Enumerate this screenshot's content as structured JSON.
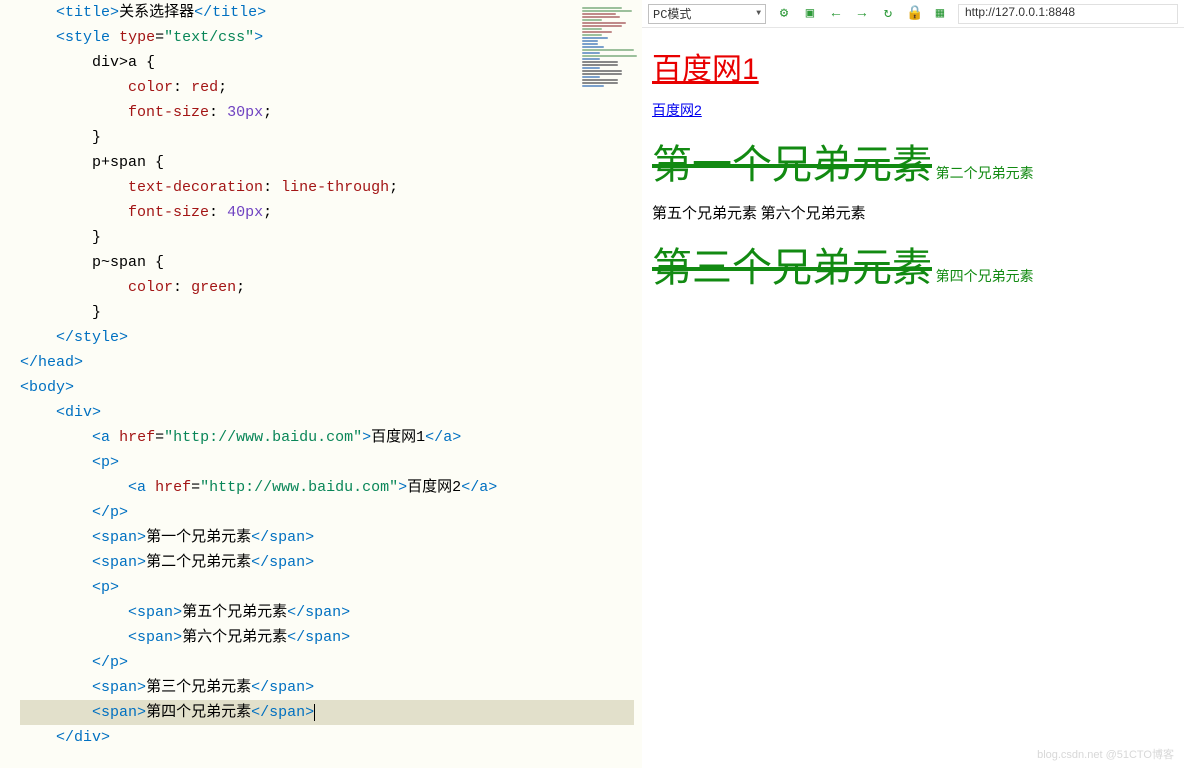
{
  "code": {
    "lines": [
      [
        [
          "sp",
          "    "
        ],
        [
          "b",
          "<"
        ],
        [
          "tag",
          "title"
        ],
        [
          "b",
          ">"
        ],
        [
          "text",
          "关系选择器"
        ],
        [
          "b",
          "</"
        ],
        [
          "tag",
          "title"
        ],
        [
          "b",
          ">"
        ]
      ],
      [
        [
          "sp",
          "    "
        ],
        [
          "b",
          "<"
        ],
        [
          "tag",
          "style"
        ],
        [
          "text",
          " "
        ],
        [
          "attr",
          "type"
        ],
        [
          "text",
          "="
        ],
        [
          "str",
          "\"text/css\""
        ],
        [
          "b",
          ">"
        ]
      ],
      [
        [
          "sp",
          "        "
        ],
        [
          "sel",
          "div>a {"
        ]
      ],
      [
        [
          "sp",
          "            "
        ],
        [
          "prop",
          "color"
        ],
        [
          "text",
          ": "
        ],
        [
          "valr",
          "red"
        ],
        [
          "text",
          ";"
        ]
      ],
      [
        [
          "sp",
          "            "
        ],
        [
          "prop",
          "font-size"
        ],
        [
          "text",
          ": "
        ],
        [
          "valn",
          "30px"
        ],
        [
          "text",
          ";"
        ]
      ],
      [
        [
          "sp",
          "        "
        ],
        [
          "sel",
          "}"
        ]
      ],
      [
        [
          "sp",
          "        "
        ],
        [
          "sel",
          "p+span {"
        ]
      ],
      [
        [
          "sp",
          "            "
        ],
        [
          "prop",
          "text-decoration"
        ],
        [
          "text",
          ": "
        ],
        [
          "valr",
          "line-through"
        ],
        [
          "text",
          ";"
        ]
      ],
      [
        [
          "sp",
          "            "
        ],
        [
          "prop",
          "font-size"
        ],
        [
          "text",
          ": "
        ],
        [
          "valn",
          "40px"
        ],
        [
          "text",
          ";"
        ]
      ],
      [
        [
          "sp",
          "        "
        ],
        [
          "sel",
          "}"
        ]
      ],
      [
        [
          "sp",
          "        "
        ],
        [
          "sel",
          "p~span {"
        ]
      ],
      [
        [
          "sp",
          "            "
        ],
        [
          "prop",
          "color"
        ],
        [
          "text",
          ": "
        ],
        [
          "valr",
          "green"
        ],
        [
          "text",
          ";"
        ]
      ],
      [
        [
          "sp",
          "        "
        ],
        [
          "sel",
          "}"
        ]
      ],
      [
        [
          "sp",
          "    "
        ],
        [
          "b",
          "</"
        ],
        [
          "tag",
          "style"
        ],
        [
          "b",
          ">"
        ]
      ],
      [
        [
          "b",
          "</"
        ],
        [
          "tag",
          "head"
        ],
        [
          "b",
          ">"
        ]
      ],
      [
        [
          "b",
          "<"
        ],
        [
          "tag",
          "body"
        ],
        [
          "b",
          ">"
        ]
      ],
      [
        [
          "sp",
          "    "
        ],
        [
          "b",
          "<"
        ],
        [
          "tag",
          "div"
        ],
        [
          "b",
          ">"
        ]
      ],
      [
        [
          "sp",
          "        "
        ],
        [
          "b",
          "<"
        ],
        [
          "tag",
          "a"
        ],
        [
          "text",
          " "
        ],
        [
          "attr",
          "href"
        ],
        [
          "text",
          "="
        ],
        [
          "str",
          "\"http://www.baidu.com\""
        ],
        [
          "b",
          ">"
        ],
        [
          "text",
          "百度网1"
        ],
        [
          "b",
          "</"
        ],
        [
          "tag",
          "a"
        ],
        [
          "b",
          ">"
        ]
      ],
      [
        [
          "sp",
          "        "
        ],
        [
          "b",
          "<"
        ],
        [
          "tag",
          "p"
        ],
        [
          "b",
          ">"
        ]
      ],
      [
        [
          "sp",
          "            "
        ],
        [
          "b",
          "<"
        ],
        [
          "tag",
          "a"
        ],
        [
          "text",
          " "
        ],
        [
          "attr",
          "href"
        ],
        [
          "text",
          "="
        ],
        [
          "str",
          "\"http://www.baidu.com\""
        ],
        [
          "b",
          ">"
        ],
        [
          "text",
          "百度网2"
        ],
        [
          "b",
          "</"
        ],
        [
          "tag",
          "a"
        ],
        [
          "b",
          ">"
        ]
      ],
      [
        [
          "sp",
          "        "
        ],
        [
          "b",
          "</"
        ],
        [
          "tag",
          "p"
        ],
        [
          "b",
          ">"
        ]
      ],
      [
        [
          "sp",
          "        "
        ],
        [
          "b",
          "<"
        ],
        [
          "tag",
          "span"
        ],
        [
          "b",
          ">"
        ],
        [
          "text",
          "第一个兄弟元素"
        ],
        [
          "b",
          "</"
        ],
        [
          "tag",
          "span"
        ],
        [
          "b",
          ">"
        ]
      ],
      [
        [
          "sp",
          "        "
        ],
        [
          "b",
          "<"
        ],
        [
          "tag",
          "span"
        ],
        [
          "b",
          ">"
        ],
        [
          "text",
          "第二个兄弟元素"
        ],
        [
          "b",
          "</"
        ],
        [
          "tag",
          "span"
        ],
        [
          "b",
          ">"
        ]
      ],
      [
        [
          "sp",
          "        "
        ],
        [
          "b",
          "<"
        ],
        [
          "tag",
          "p"
        ],
        [
          "b",
          ">"
        ]
      ],
      [
        [
          "sp",
          "            "
        ],
        [
          "b",
          "<"
        ],
        [
          "tag",
          "span"
        ],
        [
          "b",
          ">"
        ],
        [
          "text",
          "第五个兄弟元素"
        ],
        [
          "b",
          "</"
        ],
        [
          "tag",
          "span"
        ],
        [
          "b",
          ">"
        ]
      ],
      [
        [
          "sp",
          "            "
        ],
        [
          "b",
          "<"
        ],
        [
          "tag",
          "span"
        ],
        [
          "b",
          ">"
        ],
        [
          "text",
          "第六个兄弟元素"
        ],
        [
          "b",
          "</"
        ],
        [
          "tag",
          "span"
        ],
        [
          "b",
          ">"
        ]
      ],
      [
        [
          "sp",
          "        "
        ],
        [
          "b",
          "</"
        ],
        [
          "tag",
          "p"
        ],
        [
          "b",
          ">"
        ]
      ],
      [
        [
          "sp",
          "        "
        ],
        [
          "b",
          "<"
        ],
        [
          "tag",
          "span"
        ],
        [
          "b",
          ">"
        ],
        [
          "text",
          "第三个兄弟元素"
        ],
        [
          "b",
          "</"
        ],
        [
          "tag",
          "span"
        ],
        [
          "b",
          ">"
        ]
      ],
      [
        [
          "sp",
          "        "
        ],
        [
          "b",
          "<"
        ],
        [
          "tag",
          "span"
        ],
        [
          "b",
          ">"
        ],
        [
          "text",
          "第四个兄弟元素"
        ],
        [
          "b",
          "</"
        ],
        [
          "tag",
          "span"
        ],
        [
          "b",
          ">"
        ]
      ],
      [
        [
          "sp",
          "    "
        ],
        [
          "b",
          "</"
        ],
        [
          "tag",
          "div"
        ],
        [
          "b",
          ">"
        ]
      ]
    ],
    "highlight_index": 28
  },
  "toolbar": {
    "mode_label": "PC模式",
    "url": "http://127.0.0.1:8848",
    "icons": {
      "settings": "⚙",
      "inspect": "▣",
      "back": "←",
      "forward": "→",
      "reload": "↻",
      "lock": "🔒",
      "qr": "▦"
    }
  },
  "preview": {
    "link1": "百度网1",
    "link2": "百度网2",
    "span1": "第一个兄弟元素",
    "span2": "第二个兄弟元素",
    "span5": "第五个兄弟元素",
    "span6": "第六个兄弟元素",
    "span3": "第三个兄弟元素",
    "span4": "第四个兄弟元素"
  },
  "watermark": "blog.csdn.net @51CTO博客"
}
